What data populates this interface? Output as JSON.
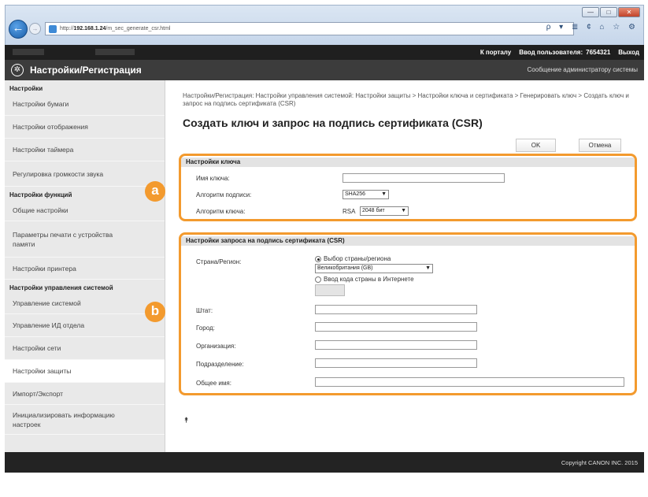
{
  "browser": {
    "url_prefix": "http://",
    "url_host": "192.168.1.24",
    "url_path": "/m_sec_generate_csr.html",
    "tools": "ρ ▾ ≣ ¢   ⌂ ☆ ⚙",
    "win_min": "—",
    "win_max": "□",
    "win_close": "✕"
  },
  "topbar": {
    "portal_link": "К порталу",
    "login_label": "Ввод пользователя:",
    "user_id": "7654321",
    "logout": "Выход"
  },
  "header": {
    "title": "Настройки/Регистрация",
    "admin_message": "Сообщение администратору системы"
  },
  "sidebar": {
    "groups": [
      {
        "title": "Настройки",
        "items": [
          {
            "label": "Настройки бумаги"
          },
          {
            "label": "Настройки отображения"
          },
          {
            "label": "Настройки таймера"
          },
          {
            "label": "Регулировка громкости звука"
          }
        ]
      },
      {
        "title": "Настройки функций",
        "items": [
          {
            "label": "Общие настройки"
          },
          {
            "label": "Параметры печати с устройства памяти"
          },
          {
            "label": "Настройки принтера"
          }
        ]
      },
      {
        "title": "Настройки управления системой",
        "items": [
          {
            "label": "Управление системой"
          },
          {
            "label": "Управление ИД отдела"
          },
          {
            "label": "Настройки сети"
          },
          {
            "label": "Настройки защиты"
          },
          {
            "label": "Импорт/Экспорт"
          },
          {
            "label": "Инициализировать информацию настроек"
          }
        ]
      }
    ]
  },
  "main": {
    "breadcrumb": "Настройки/Регистрация: Настройки управления системой: Настройки защиты > Настройки ключа и сертификата > Генерировать ключ > Создать ключ и запрос на подпись сертификата (CSR)",
    "title": "Создать ключ и запрос на подпись сертификата (CSR)",
    "ok_label": "OK",
    "cancel_label": "Отмена",
    "marker_a": "a",
    "marker_b": "b",
    "to_top": "⯭"
  },
  "key_settings": {
    "heading": "Настройки ключа",
    "key_name_label": "Имя ключа:",
    "key_name_value": "",
    "sign_alg_label": "Алгоритм подписи:",
    "sign_alg_value": "SHA256",
    "key_alg_label": "Алгоритм ключа:",
    "key_alg_prefix": "RSA",
    "key_alg_value": "2048 бит"
  },
  "csr_settings": {
    "heading": "Настройки запроса на подпись сертификата (CSR)",
    "country_label": "Страна/Регион:",
    "radio_select_label": "Выбор страны/региона",
    "country_value": "Великобритания (GB)",
    "radio_code_label": "Ввод кода страны в Интернете",
    "state_label": "Штат:",
    "city_label": "Город:",
    "org_label": "Организация:",
    "unit_label": "Подразделение:",
    "common_name_label": "Общее имя:"
  },
  "footer": {
    "copyright": "Copyright CANON INC. 2015"
  },
  "colors": {
    "accent": "#f39a2e",
    "dark_bar": "#1f1f1f",
    "title_bar": "#3c3c3c"
  }
}
